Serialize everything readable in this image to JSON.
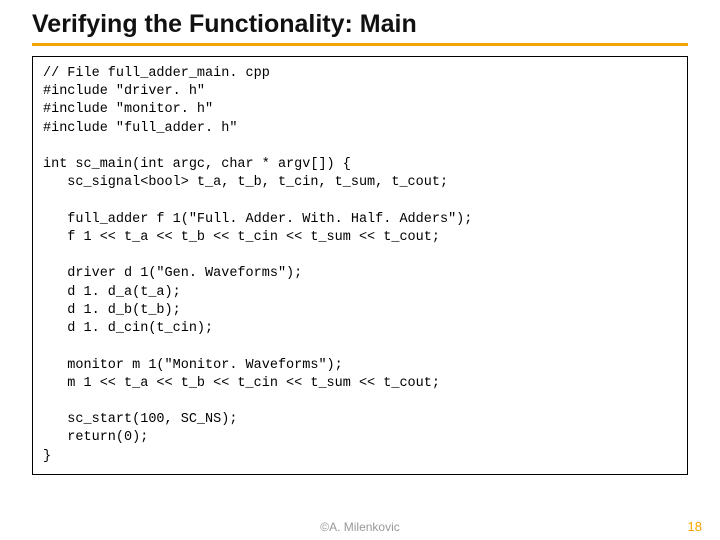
{
  "title": "Verifying the Functionality: Main",
  "code": "// File full_adder_main. cpp\n#include \"driver. h\"\n#include \"monitor. h\"\n#include \"full_adder. h\"\n\nint sc_main(int argc, char * argv[]) {\n   sc_signal<bool> t_a, t_b, t_cin, t_sum, t_cout;\n\n   full_adder f 1(\"Full. Adder. With. Half. Adders\");\n   f 1 << t_a << t_b << t_cin << t_sum << t_cout;\n\n   driver d 1(\"Gen. Waveforms\");\n   d 1. d_a(t_a);\n   d 1. d_b(t_b);\n   d 1. d_cin(t_cin);\n\n   monitor m 1(\"Monitor. Waveforms\");\n   m 1 << t_a << t_b << t_cin << t_sum << t_cout;\n\n   sc_start(100, SC_NS);\n   return(0);\n}",
  "footer": "©A. Milenkovic",
  "page": "18"
}
